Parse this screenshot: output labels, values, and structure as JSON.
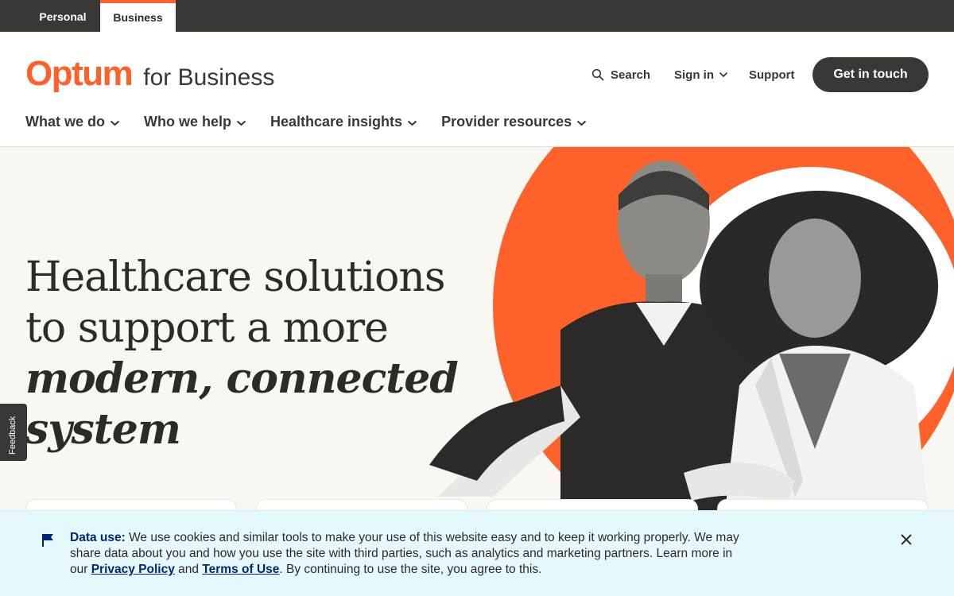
{
  "audience_tabs": {
    "personal": "Personal",
    "business": "Business"
  },
  "header": {
    "brand": "Optum",
    "brand_suffix": "for Business",
    "search_label": "Search",
    "signin_label": "Sign in",
    "support_label": "Support",
    "cta_label": "Get in touch"
  },
  "nav": {
    "items": [
      {
        "label": "What we do"
      },
      {
        "label": "Who we help"
      },
      {
        "label": "Healthcare insights"
      },
      {
        "label": "Provider resources"
      }
    ]
  },
  "hero": {
    "line1": "Healthcare solutions",
    "line2": "to support a more",
    "emphasis1": "modern, connected",
    "emphasis2": "system"
  },
  "feedback_label": "Feedback",
  "cookie": {
    "title": "Data use:",
    "text1": " We use cookies and similar tools to make your use of this website easy and to keep it working properly. We may share data about you and how you use the site with third parties, such as analytics and marketing partners. Learn more in our ",
    "privacy_link": "Privacy Policy",
    "and": " and ",
    "terms_link": "Terms of Use",
    "text2": ". By continuing to use the site, you agree to this."
  },
  "colors": {
    "brand_orange": "#ff612b",
    "dark": "#3a3734",
    "banner_bg": "#e5f8fb",
    "link_blue": "#002677"
  },
  "icons": [
    "search-icon",
    "chevron-down-icon",
    "flag-icon",
    "close-icon"
  ]
}
